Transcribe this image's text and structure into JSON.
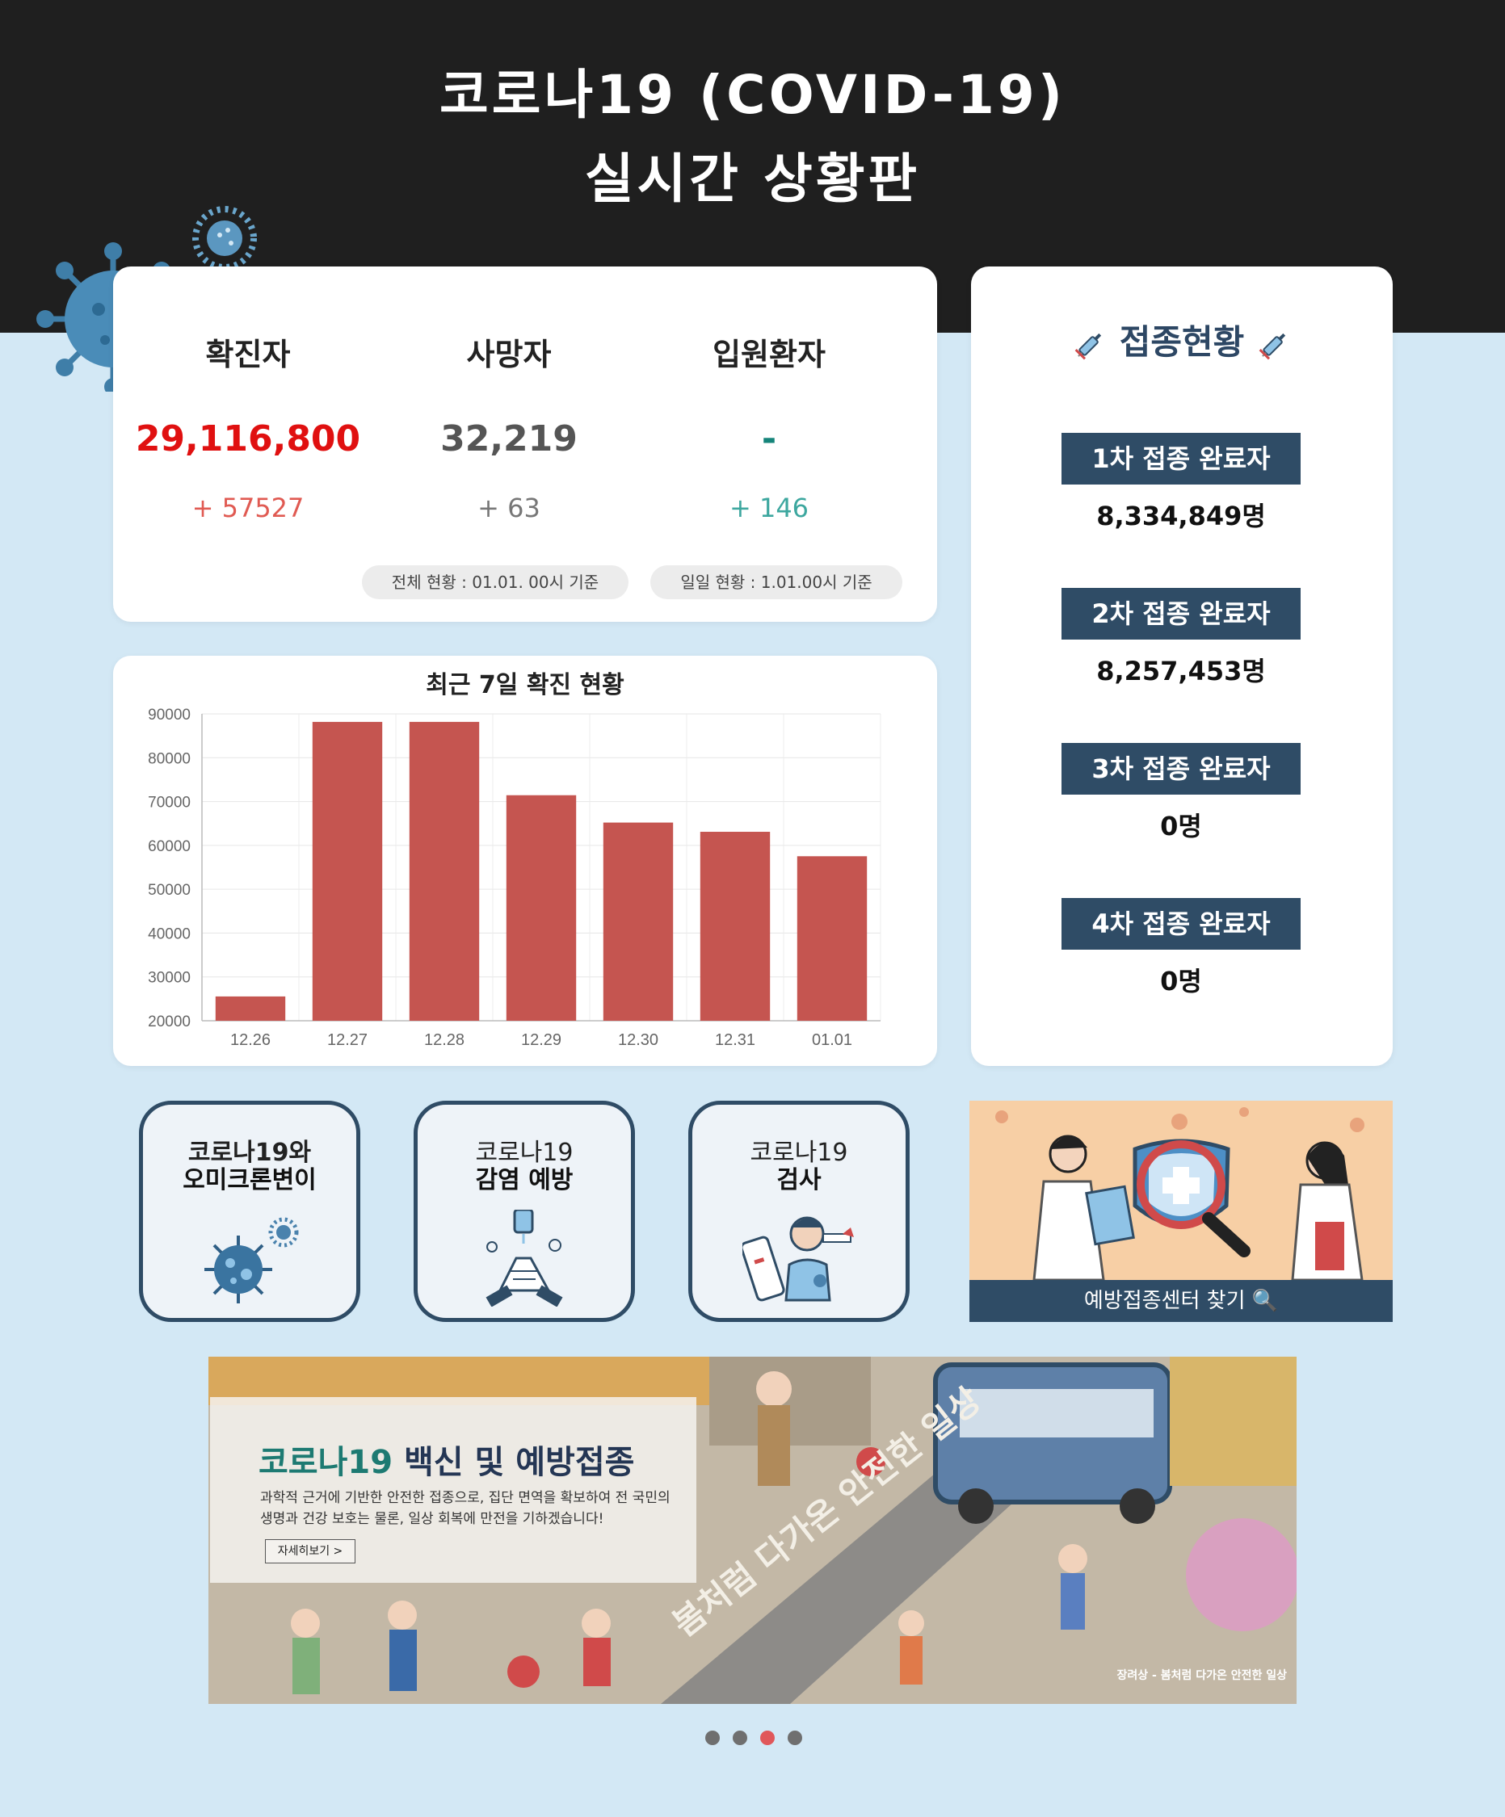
{
  "header": {
    "title_line1": "코로나19 (COVID-19)",
    "title_line2": "실시간 상황판"
  },
  "stats": {
    "confirmed": {
      "label": "확진자",
      "value": "29,116,800",
      "delta": "+ 57527"
    },
    "deaths": {
      "label": "사망자",
      "value": "32,219",
      "delta": "+ 63"
    },
    "hospitalized": {
      "label": "입원환자",
      "value": "-",
      "delta": "+ 146"
    },
    "basis_total": "전체 현황 : 01.01. 00시 기준",
    "basis_daily": "일일 현황 : 1.01.00시 기준"
  },
  "chart_data": {
    "type": "bar",
    "title": "최근 7일 확진 현황",
    "xlabel": "",
    "ylabel": "",
    "categories": [
      "12.26",
      "12.27",
      "12.28",
      "12.29",
      "12.30",
      "12.31",
      "01.01"
    ],
    "values": [
      25545,
      88172,
      88175,
      71444,
      65207,
      63104,
      57527
    ],
    "ylim": [
      20000,
      90000
    ],
    "yticks": [
      90000,
      80000,
      70000,
      60000,
      50000,
      40000,
      30000,
      20000
    ],
    "grid": true,
    "bar_color": "#c55550"
  },
  "vaccination": {
    "title": "접종현황",
    "items": [
      {
        "label": "1차 접종 완료자",
        "count": "8,334,849명"
      },
      {
        "label": "2차 접종 완료자",
        "count": "8,257,453명"
      },
      {
        "label": "3차 접종 완료자",
        "count": "0명"
      },
      {
        "label": "4차 접종 완료자",
        "count": "0명"
      }
    ]
  },
  "quick_links": [
    {
      "line1": "코로나19와",
      "line2": "오미크론변이",
      "icon": "virus-icon"
    },
    {
      "line1": "코로나19",
      "line2": "감염 예방",
      "icon": "handwash-icon"
    },
    {
      "line1": "코로나19",
      "line2": "검사",
      "icon": "test-icon"
    }
  ],
  "center_banner": {
    "label": "예방접종센터 찾기 🔍"
  },
  "promo_banner": {
    "title_green": "코로나19",
    "title_dark": " 백신 및 예방접종",
    "description": "과학적 근거에 기반한 안전한 접종으로, 집단 면역을 확보하여 전 국민의 생명과 건강 보호는 물론, 일상 회복에 만전을 기하겠습니다!",
    "more_label": "자세히보기  >",
    "road_text": "봄처럼 다가온 안전한 일상",
    "caption": "장려상 - 봄처럼 다가온 안전한 일상"
  },
  "carousel": {
    "count": 4,
    "active_index": 2
  },
  "colors": {
    "header_bg": "#1f1f1f",
    "page_bg": "#d3e8f5",
    "navy": "#2f4c66",
    "red": "#e01010",
    "teal": "#15847a"
  }
}
